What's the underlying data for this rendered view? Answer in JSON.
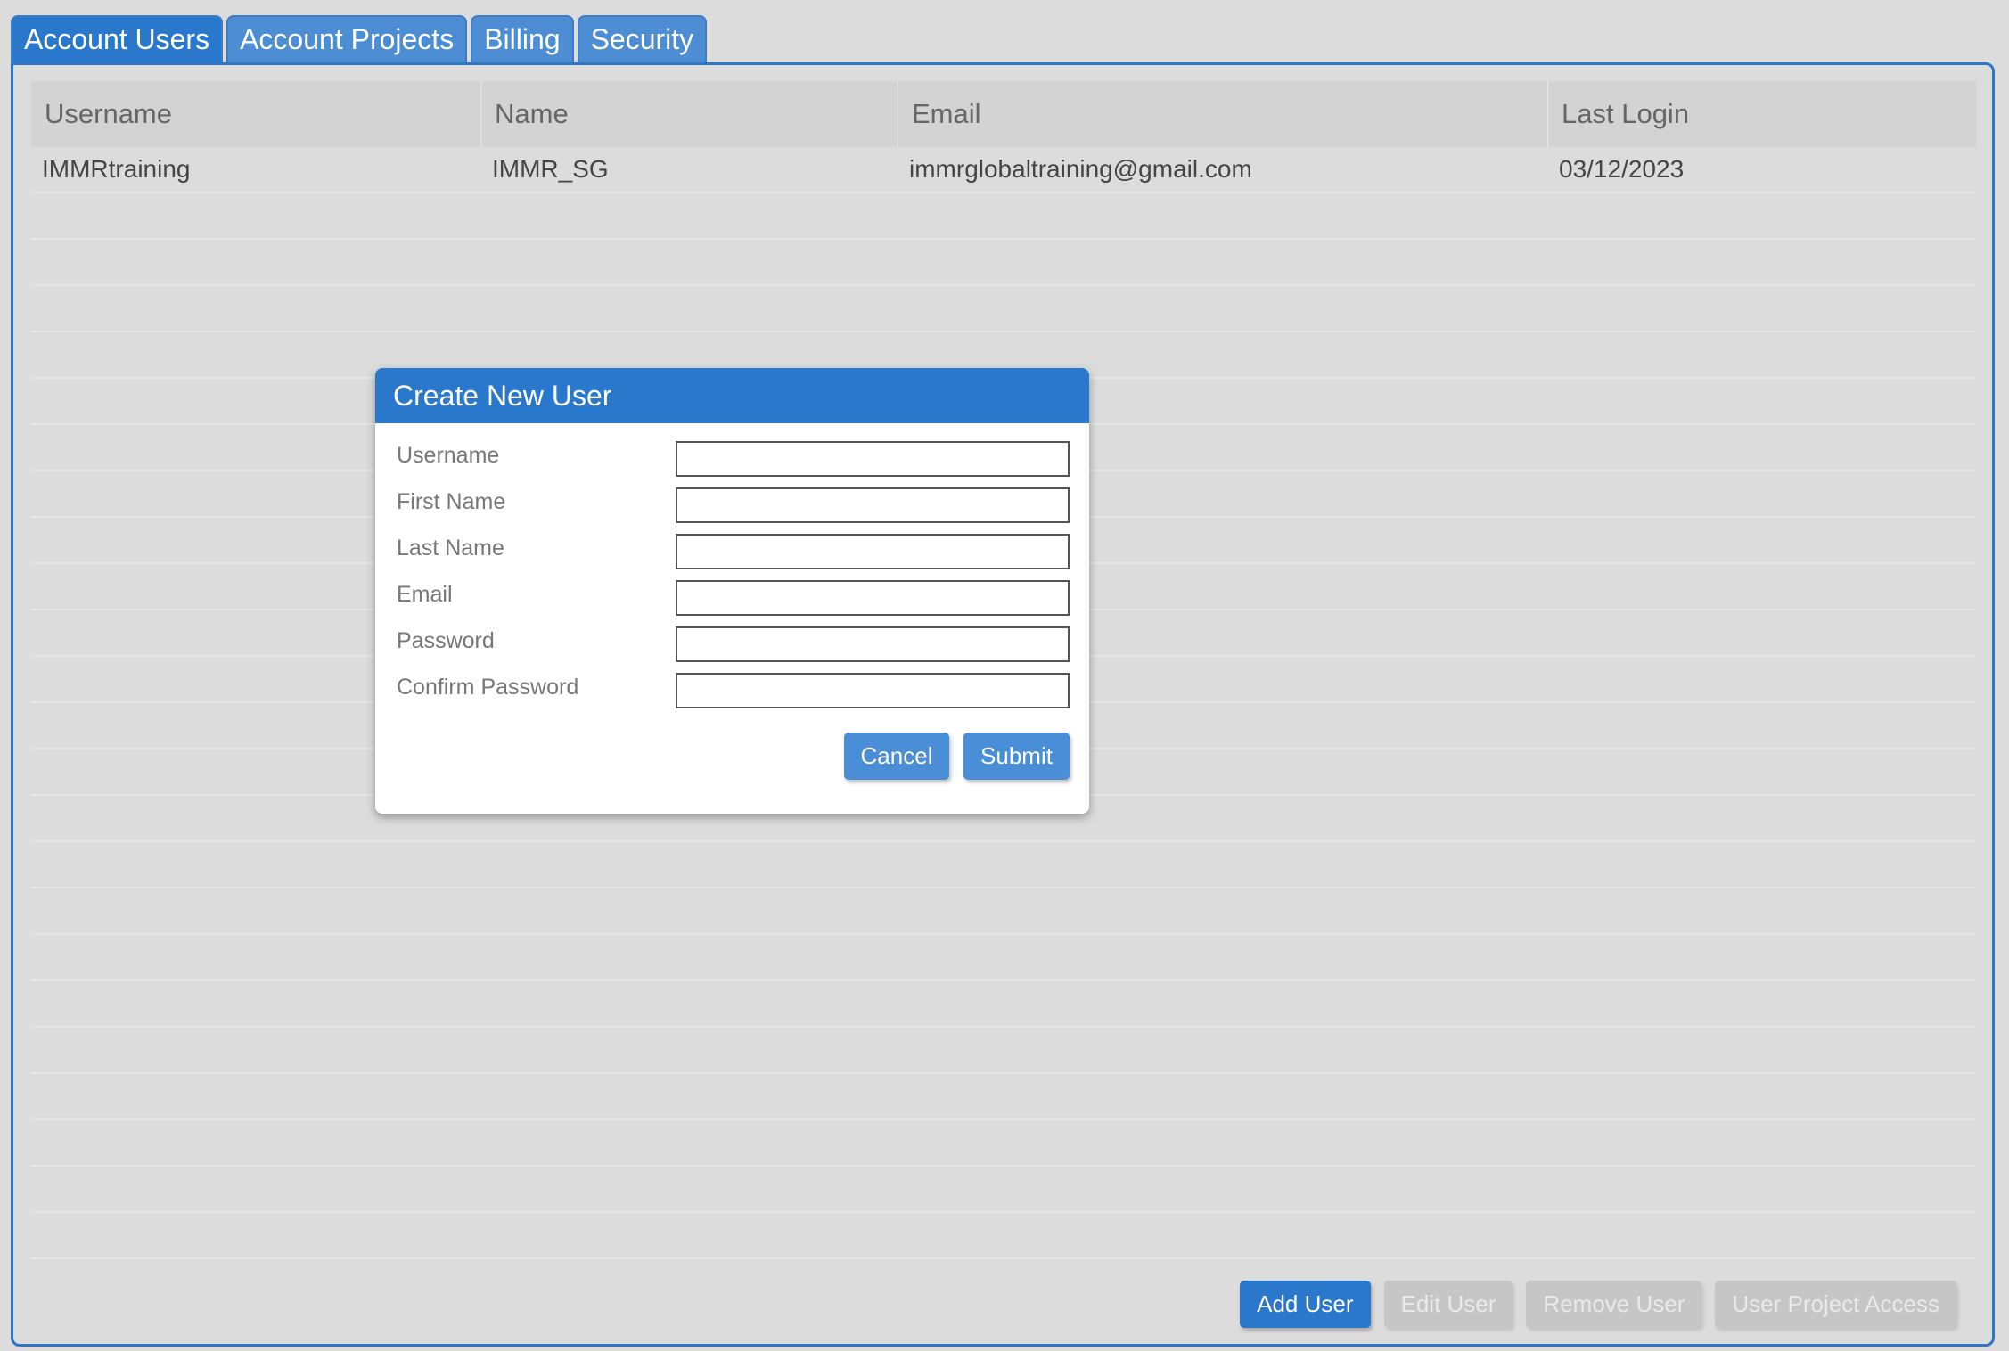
{
  "tabs": [
    {
      "label": "Account Users",
      "active": true
    },
    {
      "label": "Account Projects",
      "active": false
    },
    {
      "label": "Billing",
      "active": false
    },
    {
      "label": "Security",
      "active": false
    }
  ],
  "table": {
    "columns": [
      "Username",
      "Name",
      "Email",
      "Last Login"
    ],
    "rows": [
      [
        "IMMRtraining",
        "IMMR_SG",
        "immrglobaltraining@gmail.com",
        "03/12/2023"
      ]
    ]
  },
  "footer_buttons": {
    "add_user": "Add User",
    "edit_user": "Edit User",
    "remove_user": "Remove User",
    "user_project_access": "User Project Access"
  },
  "dialog": {
    "title": "Create New User",
    "fields": {
      "username": "Username",
      "first_name": "First Name",
      "last_name": "Last Name",
      "email": "Email",
      "password": "Password",
      "confirm_password": "Confirm Password"
    },
    "cancel_label": "Cancel",
    "submit_label": "Submit"
  },
  "colors": {
    "accent": "#2a78cc",
    "tab_inactive": "#4d8dd4",
    "disabled_button": "#c6c6c6",
    "background": "#dcdcdc"
  }
}
